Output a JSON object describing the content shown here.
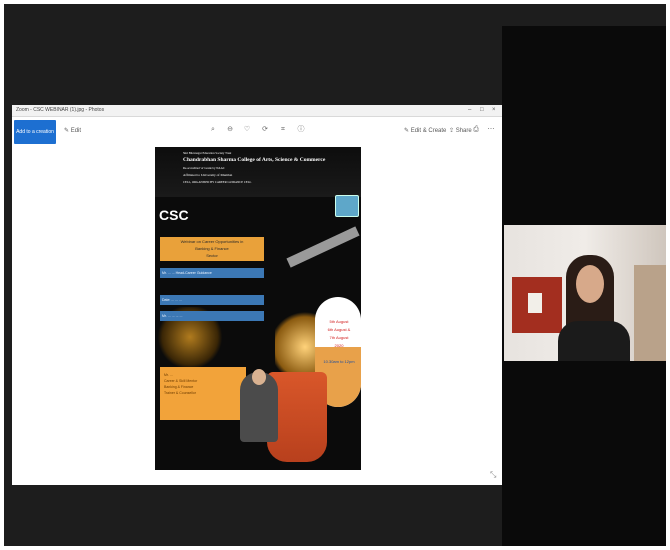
{
  "window": {
    "title": "Zoom - CSC WEBINAR (1).jpg - Photos",
    "controls": [
      "–",
      "□",
      "×"
    ]
  },
  "toolbar": {
    "primary_button": "Add to a creation",
    "edit_label": "Edit",
    "icons": [
      "zoom-in-icon",
      "delete-icon",
      "favorite-icon",
      "rotate-icon",
      "crop-icon",
      "info-icon"
    ],
    "edit_create_label": "Edit & Create",
    "share_label": "Share",
    "print_icon": "print-icon",
    "more_icon": "more-icon"
  },
  "poster": {
    "line1": "Shri Bhavnagar Education Society Trust",
    "college": "Chandrabhan Sharma College of Arts, Science & Commerce",
    "line3": "Re-accredited 'A' Grade by NAAC",
    "line4": "Affiliated to University of Mumbai",
    "line5": "CELL, ORGANISED BY CAREER GUIDANCE CELL",
    "logo_text": "CSC",
    "topic": [
      "Webinar on Career Opportunities in",
      "Banking & Finance",
      "Sector"
    ],
    "bars": [
      "Mr. ... ... Head-Career Guidance",
      "Date: ... ... ...",
      "Mr. ... ... ... ..."
    ],
    "dates": [
      "5th August",
      "6th August &",
      "7th August",
      "2020"
    ],
    "time": "10.30am to 12pm",
    "speaker_box": [
      "Mr. ...",
      "Career & Skill Mentor",
      "Banking & Finance",
      "Trainer & Counsellor"
    ]
  }
}
